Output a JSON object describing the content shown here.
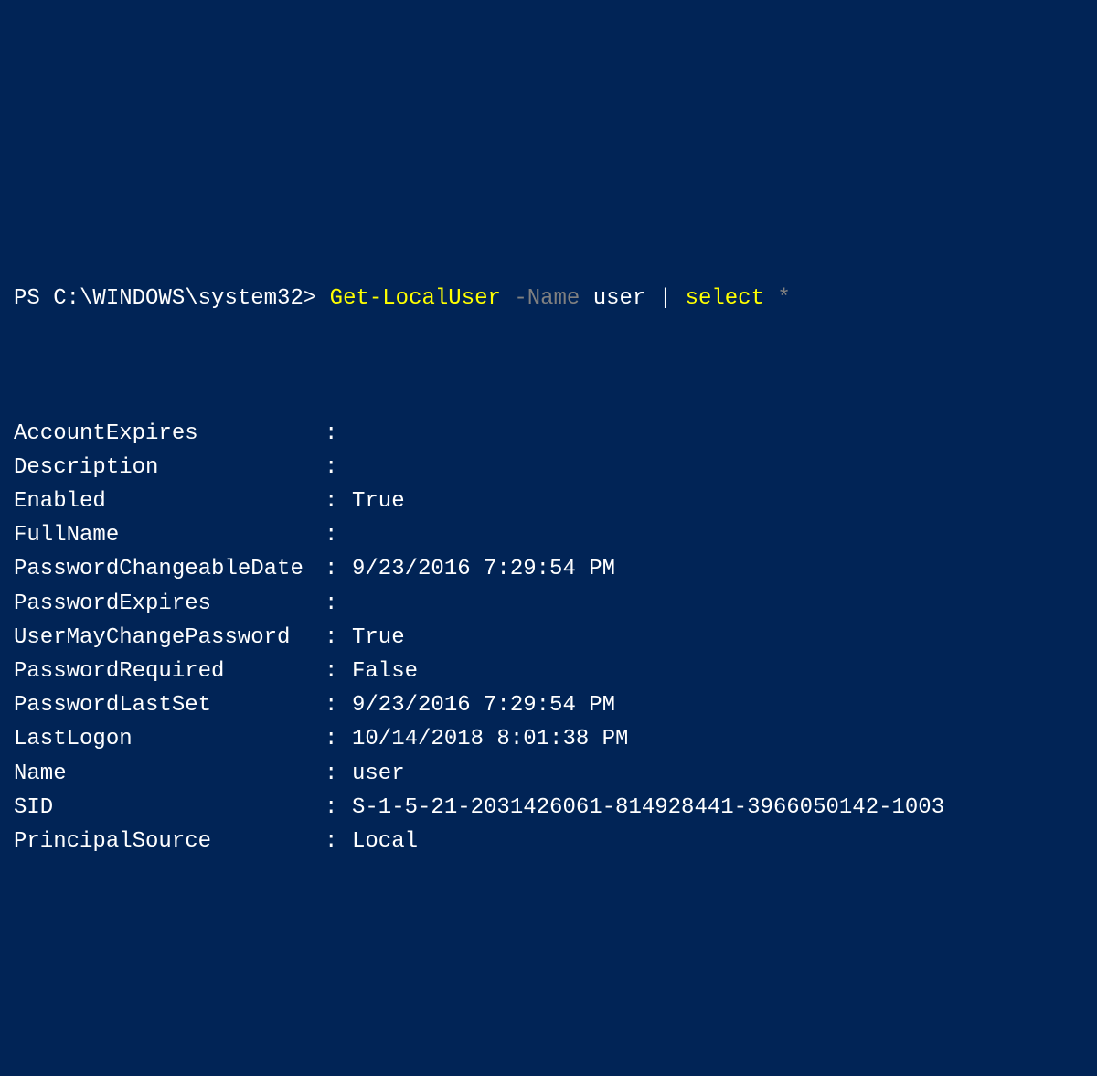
{
  "prompt": {
    "prefix": "PS C:\\WINDOWS\\system32>",
    "cmdlet": "Get-LocalUser",
    "param": "-Name",
    "arg": "user",
    "pipe": "|",
    "select": "select",
    "star": "*"
  },
  "output": [
    {
      "name": "AccountExpires",
      "value": ""
    },
    {
      "name": "Description",
      "value": ""
    },
    {
      "name": "Enabled",
      "value": "True"
    },
    {
      "name": "FullName",
      "value": ""
    },
    {
      "name": "PasswordChangeableDate",
      "value": "9/23/2016 7:29:54 PM"
    },
    {
      "name": "PasswordExpires",
      "value": ""
    },
    {
      "name": "UserMayChangePassword",
      "value": "True"
    },
    {
      "name": "PasswordRequired",
      "value": "False"
    },
    {
      "name": "PasswordLastSet",
      "value": "9/23/2016 7:29:54 PM"
    },
    {
      "name": "LastLogon",
      "value": "10/14/2018 8:01:38 PM"
    },
    {
      "name": "Name",
      "value": "user"
    },
    {
      "name": "SID",
      "value": "S-1-5-21-2031426061-814928441-3966050142-1003"
    },
    {
      "name": "PrincipalSource",
      "value": "Local"
    }
  ]
}
